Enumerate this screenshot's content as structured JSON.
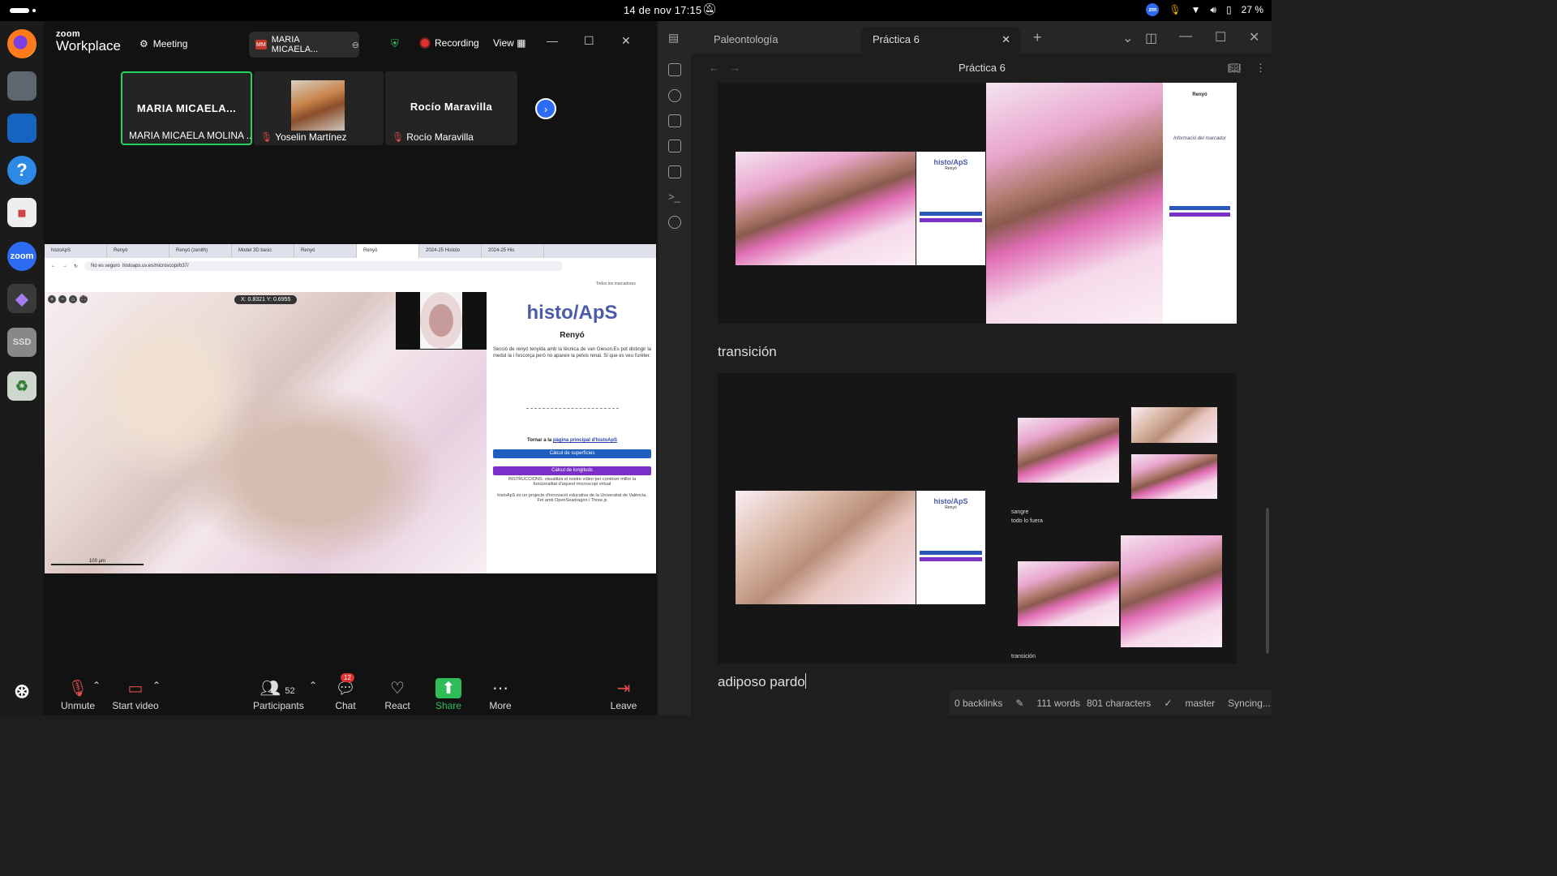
{
  "system_bar": {
    "datetime": "14 de nov  17:15",
    "battery": "27 %",
    "tray_zoom": "zm"
  },
  "dock": {
    "items": [
      "firefox-icon",
      "files-icon",
      "writer-icon",
      "help-icon",
      "calc-icon",
      "zoom-icon",
      "obsidian-icon",
      "ssd-icon",
      "trash-icon",
      "apps-icon"
    ],
    "zoom_label": "zoom",
    "ssd_label": "SSD"
  },
  "zoom": {
    "logo_top": "zoom",
    "logo_bottom": "Workplace",
    "meeting_label": "Meeting",
    "name_pill": "MARIA MICAELA...",
    "name_pill_initials": "MM",
    "recording_label": "Recording",
    "view_label": "View",
    "tiles": [
      {
        "big_name": "MARIA MICAELA...",
        "label": "MARIA MICAELA MOLINA ...",
        "muted": false
      },
      {
        "big_name": "",
        "label": "Yoselin Martínez",
        "muted": true
      },
      {
        "big_name": "Rocío Maravilla",
        "label": "Rocío Maravilla",
        "muted": true
      }
    ],
    "controls": {
      "unmute": "Unmute",
      "start_video": "Start video",
      "participants": "Participants",
      "participants_count": "52",
      "chat": "Chat",
      "chat_badge": "12",
      "react": "React",
      "share": "Share",
      "more": "More",
      "leave": "Leave"
    }
  },
  "shared_screen": {
    "tabs": [
      "histoApS",
      "Renyó",
      "Renyó (zenith)",
      "Model 3D basic",
      "Renyó",
      "Renyó",
      "2024-25 Histolo",
      "2024-25 His"
    ],
    "active_tab_index": 5,
    "security": "No es seguro",
    "url": "histoaps.uv.es/microscopi/b37/",
    "bookmarks": "Todos los marcadores",
    "coords": "X: 0.8321   Y: 0.6955",
    "scale_label": "100 µm",
    "logo": "histo/ApS",
    "title": "Renyó",
    "description": "Secció de renyó tenyida amb la tècnica de van Gieson.Es pot distingir la medul·la i l'escorça però no apareix la pelvis renal. Sí que es veu l'urèter.",
    "back_text": "Tornar a la ",
    "back_link": "pàgina principal d'histoApS",
    "btn_surface": "Càlcul de superfícies",
    "btn_length": "Càlcul de longituds",
    "instructions": "INSTRUCCIONS: visualitza el nostre vídeo per conèixer millor la funcionalitat d'aquest microscopi virtual",
    "credits": "histoApS és un projecte d'innovació educativa de la Universitat de València. Fet amb OpenSeadragon i Three.js",
    "colors": {
      "surface": "#1f5fbf",
      "length": "#7a2fc9"
    }
  },
  "obsidian": {
    "tabs": [
      {
        "label": "Paleontología",
        "active": false
      },
      {
        "label": "Práctica 6",
        "active": true
      }
    ],
    "note_title": "Práctica 6",
    "heading": "transición",
    "typed_text": "adiposo  pardo",
    "embedded_1": {
      "mini_logo": "histo/ApS",
      "mini_title": "Renyó",
      "right_title": "Renyó",
      "right_section": "Informació del marcador"
    },
    "embedded_2": {
      "mini_logo": "histo/ApS",
      "mini_title": "Renyó",
      "note_1": "sangre",
      "note_2": "todo lo fuera",
      "note_3": "transición"
    },
    "status": {
      "backlinks": "0 backlinks",
      "words": "111 words",
      "characters": "801 characters",
      "branch": "master",
      "sync": "Syncing..."
    }
  }
}
